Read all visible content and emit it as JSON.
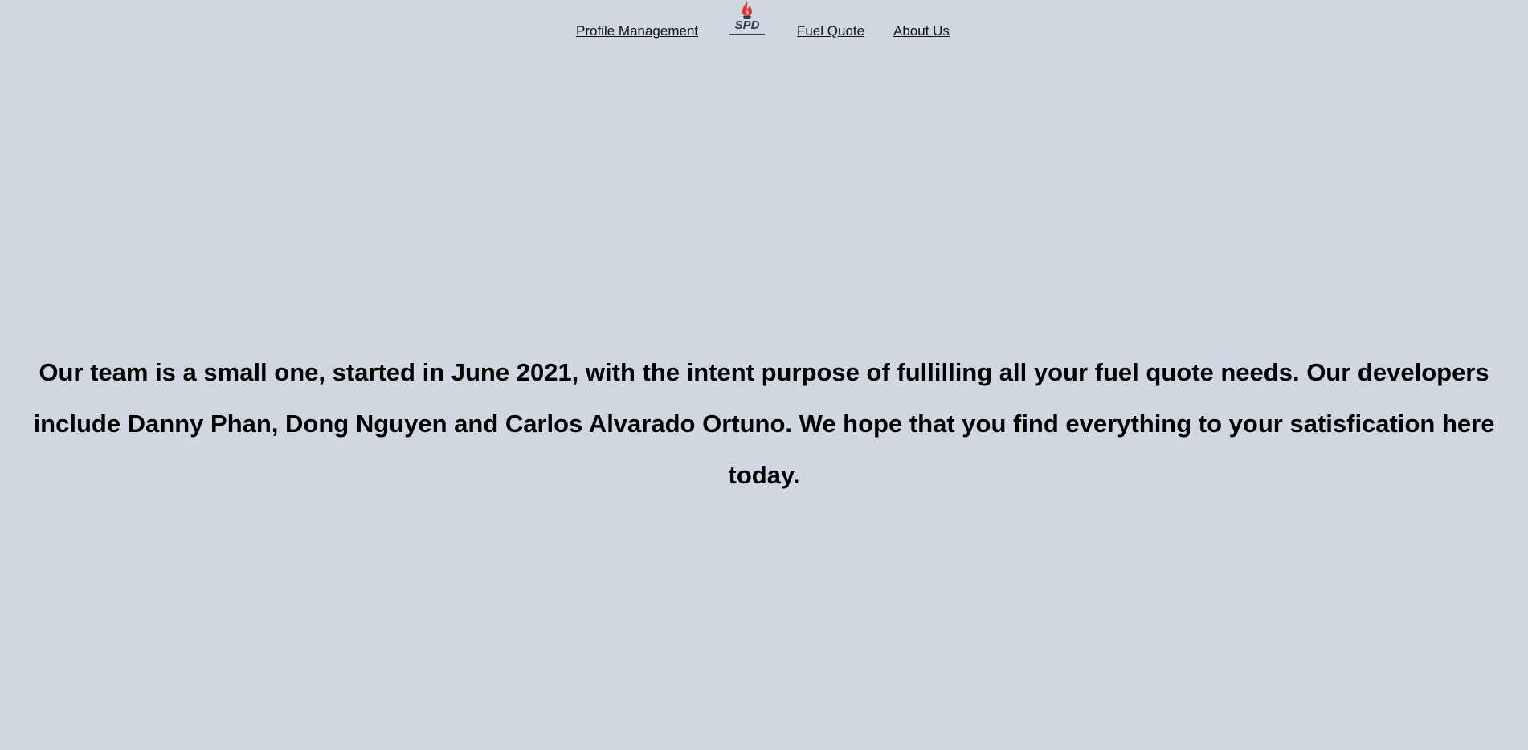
{
  "nav": {
    "profile_label": "Profile Management",
    "fuel_label": "Fuel Quote",
    "about_label": "About Us",
    "logo": {
      "icon": "flame-logo-icon",
      "text": "SPD"
    }
  },
  "main": {
    "about_text": "Our team is a small one, started in June 2021, with the intent purpose of fullilling all your fuel quote needs. Our developers include Danny Phan, Dong Nguyen and Carlos Alvarado Ortuno. We hope that you find everything to your satisfication here today."
  },
  "colors": {
    "background": "#d0d7e1",
    "flame": "#d83a3a",
    "logo_text": "#333c4a"
  }
}
